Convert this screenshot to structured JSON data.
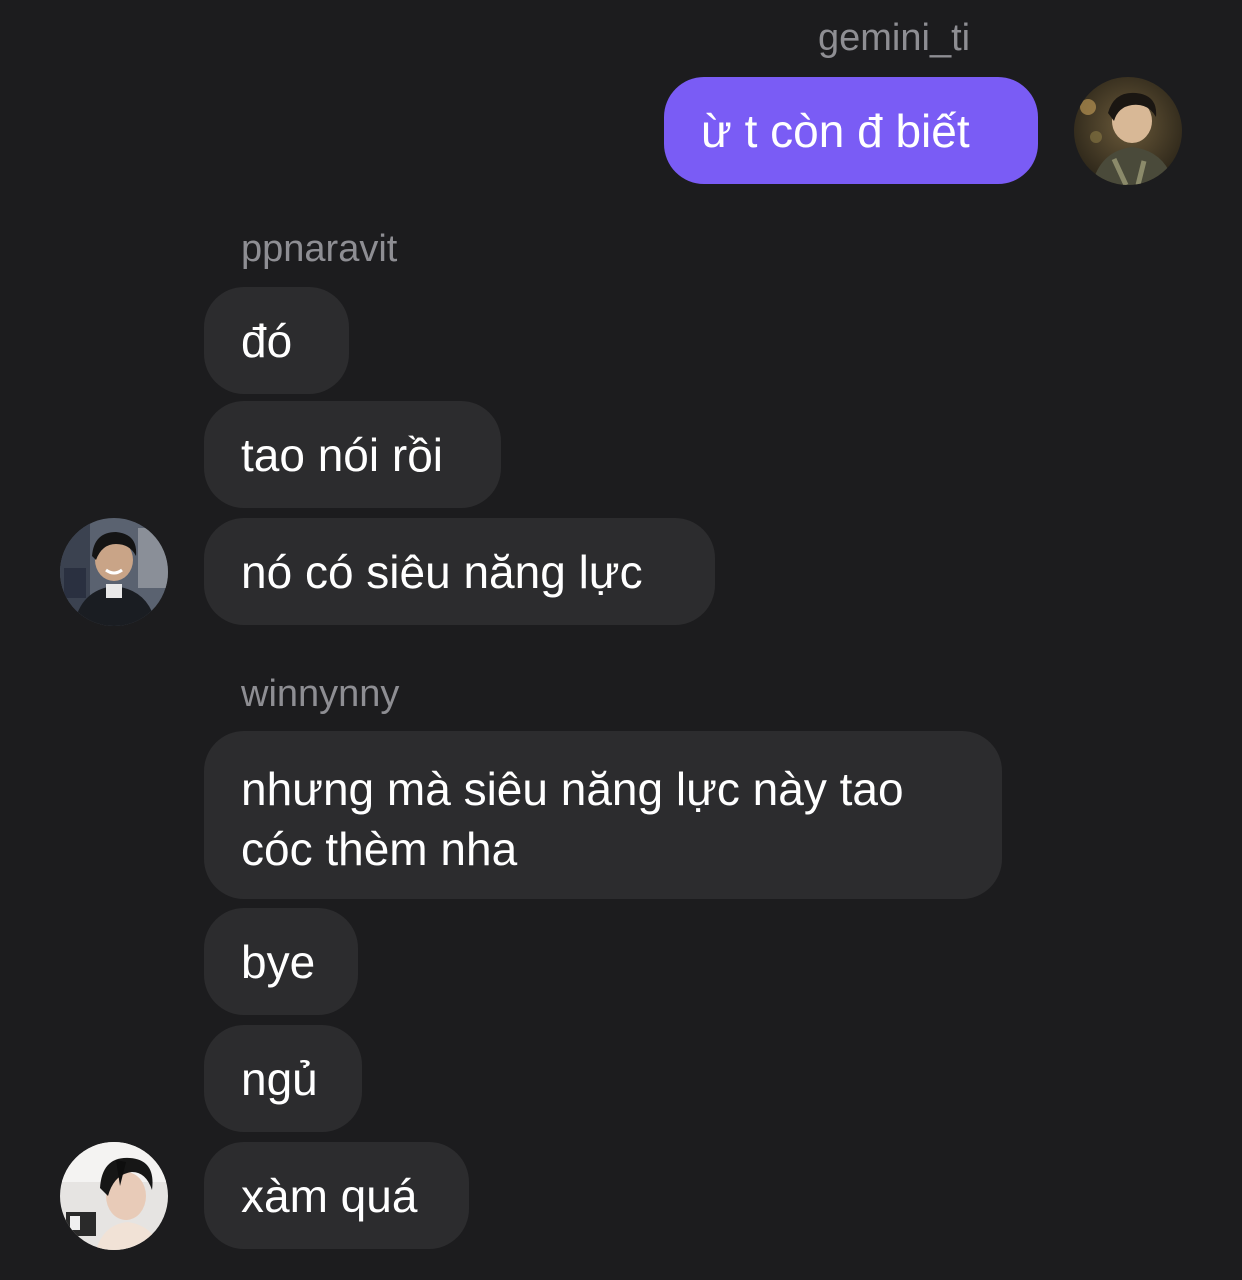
{
  "groups": [
    {
      "sender": "gemini_ti",
      "side": "outgoing",
      "avatar_icon": "user-photo-avatar",
      "messages": [
        "ừ t còn đ biết"
      ]
    },
    {
      "sender": "ppnaravit",
      "side": "incoming",
      "avatar_icon": "user-photo-avatar",
      "messages": [
        "đó",
        "tao nói rồi",
        "nó có siêu năng lực"
      ]
    },
    {
      "sender": "winnynny",
      "side": "incoming",
      "avatar_icon": "user-photo-avatar",
      "messages": [
        "nhưng mà siêu năng lực này tao cóc thèm nha",
        "bye",
        "ngủ",
        "xàm quá"
      ]
    }
  ],
  "colors": {
    "background": "#1c1c1e",
    "incoming_bubble": "#2c2c2e",
    "outgoing_bubble": "#7a5cf5",
    "sender_name": "#8e8e93",
    "message_text": "#ffffff"
  }
}
